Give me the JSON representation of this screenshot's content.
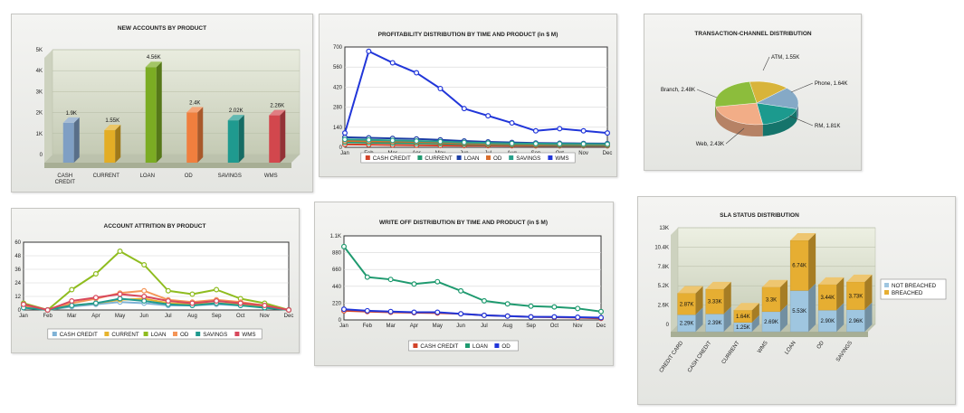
{
  "chart_data": [
    {
      "id": "accounts",
      "type": "bar",
      "title": "NEW ACCOUNTS BY PRODUCT",
      "categories": [
        "CASH CREDIT",
        "CURRENT",
        "LOAN",
        "OD",
        "SAVINGS",
        "WMS"
      ],
      "category_lines": [
        [
          "CASH",
          "CREDIT"
        ],
        [
          "CURRENT"
        ],
        [
          "LOAN"
        ],
        [
          "OD"
        ],
        [
          "SAVINGS"
        ],
        [
          "WMS"
        ]
      ],
      "values": [
        1.9,
        1.55,
        4.56,
        2.4,
        2.02,
        2.26
      ],
      "data_labels": [
        "1.9K",
        "1.55K",
        "4.56K",
        "2.4K",
        "2.02K",
        "2.26K"
      ],
      "colors": [
        "#7f9fc4",
        "#e3ad25",
        "#7bac23",
        "#f07f3e",
        "#1f9a8f",
        "#d2474d"
      ],
      "ylim": [
        0,
        5
      ],
      "yticks": [
        0,
        1,
        2,
        3,
        4,
        5
      ],
      "ytick_labels": [
        "0",
        "1K",
        "2K",
        "3K",
        "4K",
        "5K"
      ]
    },
    {
      "id": "profit",
      "type": "line",
      "title": "PROFITABILITY DISTRIBUTION BY TIME AND PRODUCT (in $ M)",
      "x": [
        "Jan",
        "Feb",
        "Mar",
        "Apr",
        "May",
        "Jun",
        "Jul",
        "Aug",
        "Sep",
        "Oct",
        "Nov",
        "Dec"
      ],
      "ylim": [
        0,
        700
      ],
      "yticks": [
        0,
        140,
        280,
        420,
        560,
        700
      ],
      "ytick_labels": [
        "0",
        "140",
        "280",
        "420",
        "560",
        "700"
      ],
      "grid": true,
      "legend": "bottom",
      "series": [
        {
          "name": "CASH CREDIT",
          "color": "#d2442a",
          "values": [
            20,
            18,
            16,
            14,
            13,
            12,
            12,
            11,
            10,
            10,
            10,
            10
          ]
        },
        {
          "name": "CURRENT",
          "color": "#1f9a6f",
          "values": [
            35,
            32,
            30,
            28,
            26,
            22,
            20,
            18,
            16,
            15,
            14,
            14
          ]
        },
        {
          "name": "LOAN",
          "color": "#1d3fa5",
          "values": [
            70,
            66,
            62,
            58,
            52,
            44,
            38,
            34,
            30,
            28,
            27,
            26
          ]
        },
        {
          "name": "OD",
          "color": "#d96d2c",
          "values": [
            45,
            42,
            40,
            38,
            34,
            28,
            24,
            22,
            20,
            20,
            19,
            18
          ]
        },
        {
          "name": "SAVINGS",
          "color": "#26a08a",
          "values": [
            55,
            52,
            48,
            44,
            40,
            34,
            30,
            27,
            25,
            24,
            23,
            22
          ]
        },
        {
          "name": "WMS",
          "color": "#2136d9",
          "values": [
            100,
            670,
            590,
            520,
            410,
            270,
            220,
            170,
            115,
            130,
            115,
            100
          ]
        }
      ]
    },
    {
      "id": "channel",
      "type": "pie",
      "title": "TRANSACTION-CHANNEL DISTRIBUTION",
      "slices": [
        {
          "name": "ATM",
          "label": "ATM, 1.55K",
          "value": 1.55,
          "color": "#d8b43a"
        },
        {
          "name": "Phone",
          "label": "Phone, 1.64K",
          "value": 1.64,
          "color": "#85a9c6"
        },
        {
          "name": "RM",
          "label": "RM, 1.81K",
          "value": 1.81,
          "color": "#1c9a8e"
        },
        {
          "name": "Web",
          "label": "Web, 2.43K",
          "value": 2.43,
          "color": "#f2ad87"
        },
        {
          "name": "Branch",
          "label": "Branch, 2.48K",
          "value": 2.48,
          "color": "#8cbd3c"
        }
      ]
    },
    {
      "id": "attrition",
      "type": "line",
      "title": "ACCOUNT ATTRITION BY PRODUCT",
      "x": [
        "Jan",
        "Feb",
        "Mar",
        "Apr",
        "May",
        "Jun",
        "Jul",
        "Aug",
        "Sep",
        "Oct",
        "Nov",
        "Dec"
      ],
      "ylim": [
        0,
        60
      ],
      "yticks": [
        0,
        12,
        24,
        36,
        48,
        60
      ],
      "ytick_labels": [
        "0",
        "12",
        "24",
        "36",
        "48",
        "60"
      ],
      "grid": true,
      "legend": "bottom",
      "series": [
        {
          "name": "CASH CREDIT",
          "color": "#7fb2d6",
          "values": [
            4,
            0,
            3,
            5,
            7,
            6,
            4,
            4,
            5,
            4,
            3,
            0
          ]
        },
        {
          "name": "CURRENT",
          "color": "#e7b42e",
          "values": [
            3,
            0,
            4,
            6,
            9,
            10,
            6,
            5,
            6,
            5,
            3,
            0
          ]
        },
        {
          "name": "LOAN",
          "color": "#8fbc1f",
          "values": [
            6,
            0,
            18,
            32,
            52,
            40,
            17,
            14,
            18,
            10,
            6,
            0
          ]
        },
        {
          "name": "OD",
          "color": "#f49557",
          "values": [
            4,
            0,
            6,
            10,
            15,
            17,
            9,
            7,
            9,
            7,
            4,
            0
          ]
        },
        {
          "name": "SAVINGS",
          "color": "#1f9a8f",
          "values": [
            2,
            0,
            4,
            6,
            10,
            8,
            5,
            4,
            6,
            4,
            2,
            0
          ]
        },
        {
          "name": "WMS",
          "color": "#d8485c",
          "values": [
            5,
            0,
            8,
            11,
            14,
            12,
            8,
            6,
            8,
            6,
            4,
            0
          ]
        }
      ]
    },
    {
      "id": "writeoff",
      "type": "line",
      "title": "WRITE OFF DISTRIBUTION BY TIME AND PRODUCT (in $ M)",
      "x": [
        "Jan",
        "Feb",
        "Mar",
        "Apr",
        "May",
        "Jun",
        "Jul",
        "Aug",
        "Sep",
        "Oct",
        "Nov",
        "Dec"
      ],
      "ylim": [
        0,
        1100
      ],
      "yticks": [
        0,
        220,
        440,
        660,
        880,
        1100
      ],
      "ytick_labels": [
        "0",
        "220",
        "440",
        "660",
        "880",
        "1.1K"
      ],
      "grid": true,
      "legend": "bottom",
      "series": [
        {
          "name": "CASH CREDIT",
          "color": "#d2442a",
          "values": [
            120,
            110,
            100,
            95,
            90,
            80,
            60,
            50,
            40,
            35,
            30,
            20
          ]
        },
        {
          "name": "LOAN",
          "color": "#1f9a6f",
          "values": [
            960,
            560,
            530,
            470,
            500,
            380,
            250,
            210,
            180,
            170,
            150,
            110
          ]
        },
        {
          "name": "OD",
          "color": "#2136d9",
          "values": [
            140,
            120,
            110,
            100,
            100,
            80,
            60,
            50,
            40,
            40,
            35,
            30
          ]
        }
      ]
    },
    {
      "id": "sla",
      "type": "bar",
      "title": "SLA STATUS DISTRIBUTION",
      "categories": [
        "CREDIT CARD",
        "CASH CREDIT",
        "CURRENT",
        "WMS",
        "LOAN",
        "OD",
        "SAVINGS"
      ],
      "ylim": [
        0,
        13
      ],
      "yticks": [
        0,
        2.6,
        5.2,
        7.8,
        10.4,
        13
      ],
      "ytick_labels": [
        "0",
        "2.6K",
        "5.2K",
        "7.8K",
        "10.4K",
        "13K"
      ],
      "legend": "right",
      "series": [
        {
          "name": "NOT BREACHED",
          "color": "#9fc6e0",
          "values": [
            2.29,
            2.39,
            1.25,
            2.69,
            5.53,
            2.9,
            2.96
          ],
          "data_labels": [
            "2.29K",
            "2.39K",
            "1.25K",
            "2.69K",
            "5.53K",
            "2.90K",
            "2.96K"
          ]
        },
        {
          "name": "BREACHED",
          "color": "#e6ae32",
          "values": [
            2.87,
            3.33,
            1.64,
            3.3,
            6.74,
            3.44,
            3.73
          ],
          "data_labels": [
            "2.87K",
            "3.33K",
            "1.64K",
            "3.3K",
            "6.74K",
            "3.44K",
            "3.73K"
          ]
        }
      ]
    }
  ]
}
